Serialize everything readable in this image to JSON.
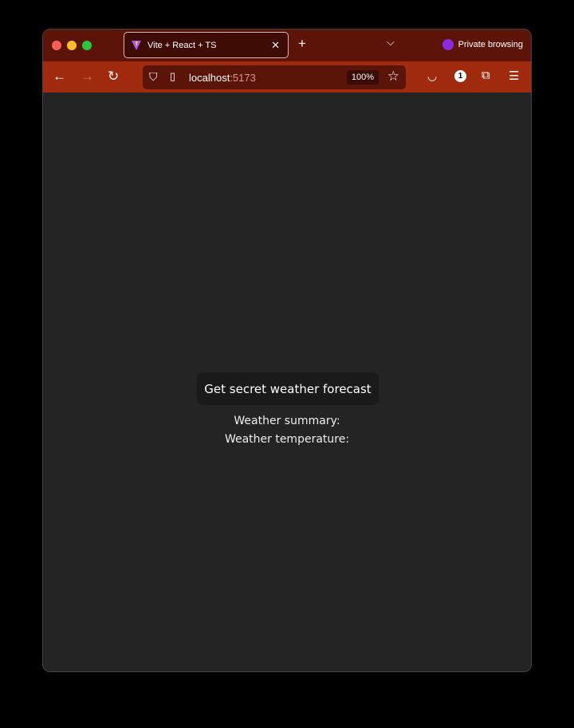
{
  "browser": {
    "tab_title": "Vite + React + TS",
    "private_label": "Private browsing",
    "url_host": "localhost",
    "url_port": ":5173",
    "zoom": "100%",
    "notification_count": "1"
  },
  "page": {
    "button_label": "Get secret weather forecast",
    "summary_label": "Weather summary:",
    "temperature_label": "Weather temperature:"
  }
}
